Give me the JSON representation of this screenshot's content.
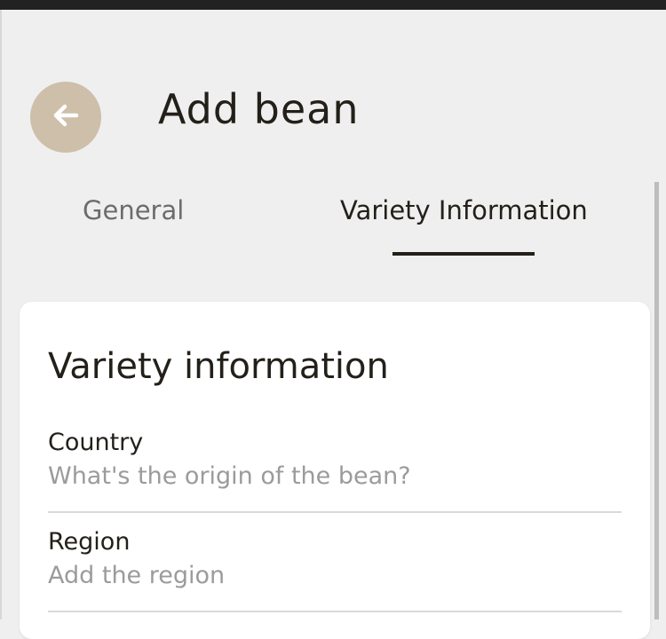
{
  "header": {
    "back_icon": "arrow-left-icon",
    "title": "Add bean"
  },
  "tabs": [
    {
      "label": "General",
      "active": false
    },
    {
      "label": "Variety Information",
      "active": true
    }
  ],
  "card": {
    "title": "Variety information",
    "fields": [
      {
        "label": "Country",
        "placeholder": "What's the origin of the bean?",
        "value": ""
      },
      {
        "label": "Region",
        "placeholder": "Add the region",
        "value": ""
      }
    ]
  },
  "colors": {
    "background": "#efefef",
    "accent": "#cdbfa9",
    "text": "#23201a",
    "muted": "#6c6c6c",
    "placeholder": "#9b9b9b"
  }
}
